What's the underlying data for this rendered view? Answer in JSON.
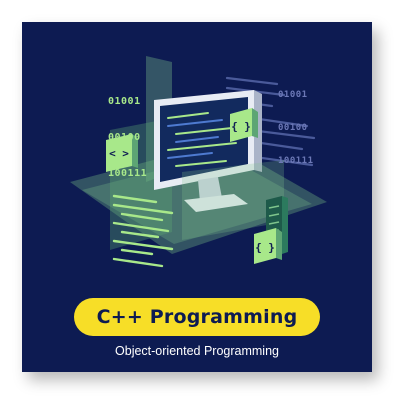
{
  "title": "C++ Programming",
  "subtitle": "Object-oriented Programming",
  "binary_left": [
    "01001",
    "00100",
    "100111"
  ],
  "binary_right": [
    "01001",
    "00100",
    "100111"
  ],
  "badges": {
    "left": "< >",
    "right": "{ }",
    "bottom": "{ }"
  },
  "colors": {
    "background": "#0d1b52",
    "accent_green": "#a8e88a",
    "title_pill": "#f7de27"
  },
  "icons": [
    "monitor-icon",
    "code-brackets-icon",
    "curly-braces-icon"
  ]
}
